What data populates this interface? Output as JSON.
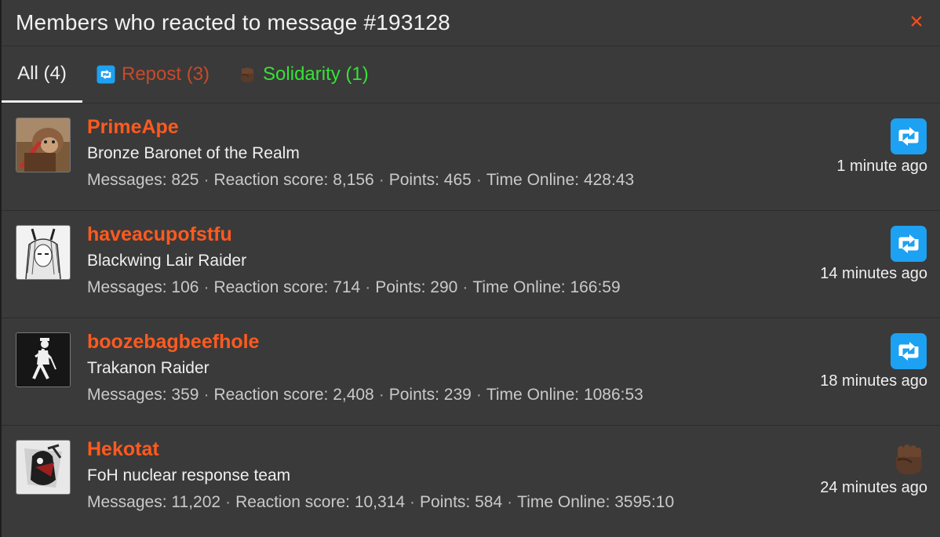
{
  "dialog": {
    "title": "Members who reacted to message #193128",
    "close_label": "×"
  },
  "tabs": [
    {
      "label": "All (4)",
      "active": true,
      "icon": null
    },
    {
      "label": "Repost (3)",
      "active": false,
      "icon": "repost-icon",
      "color": "#c84a2a"
    },
    {
      "label": "Solidarity (1)",
      "active": false,
      "icon": "fist-icon",
      "color": "#36e236"
    }
  ],
  "members": [
    {
      "name": "PrimeApe",
      "title": "Bronze Baronet of the Realm",
      "messages_label": "Messages:",
      "messages": "825",
      "reaction_label": "Reaction score:",
      "reaction": "8,156",
      "points_label": "Points:",
      "points": "465",
      "online_label": "Time Online:",
      "online": "428:43",
      "reaction_icon": "repost-icon",
      "time": "1 minute ago",
      "avatar": "monkey-avatar"
    },
    {
      "name": "haveacupofstfu",
      "title": "Blackwing Lair Raider",
      "messages_label": "Messages:",
      "messages": "106",
      "reaction_label": "Reaction score:",
      "reaction": "714",
      "points_label": "Points:",
      "points": "290",
      "online_label": "Time Online:",
      "online": "166:59",
      "reaction_icon": "repost-icon",
      "time": "14 minutes ago",
      "avatar": "anime-horns-avatar"
    },
    {
      "name": "boozebagbeefhole",
      "title": "Trakanon Raider",
      "messages_label": "Messages:",
      "messages": "359",
      "reaction_label": "Reaction score:",
      "reaction": "2,408",
      "points_label": "Points:",
      "points": "239",
      "online_label": "Time Online:",
      "online": "1086:53",
      "reaction_icon": "repost-icon",
      "time": "18 minutes ago",
      "avatar": "striding-man-avatar"
    },
    {
      "name": "Hekotat",
      "title": "FoH nuclear response team",
      "messages_label": "Messages:",
      "messages": "11,202",
      "reaction_label": "Reaction score:",
      "reaction": "10,314",
      "points_label": "Points:",
      "points": "584",
      "online_label": "Time Online:",
      "online": "3595:10",
      "reaction_icon": "fist-icon",
      "time": "24 minutes ago",
      "avatar": "dark-warrior-avatar"
    }
  ],
  "colors": {
    "accent": "#ff5a1f",
    "panel": "#3a3a3a",
    "repost_blue": "#1da1f2",
    "solidarity_green": "#36e236",
    "fist_brown": "#6b4530"
  }
}
